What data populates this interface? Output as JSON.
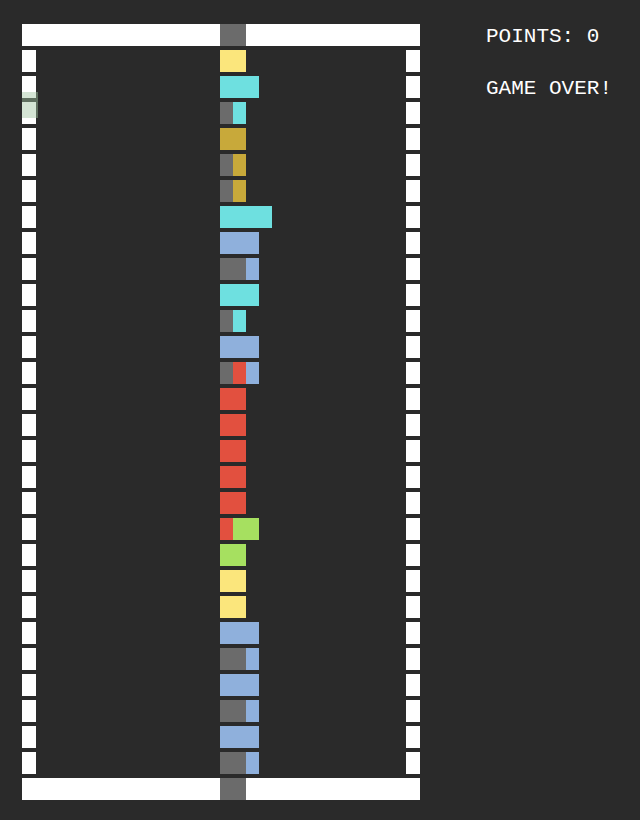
{
  "status": {
    "points": "POINTS: 0",
    "message": "GAME OVER!"
  },
  "ghost_piece": {
    "visible": true,
    "color": "#9fc49f"
  },
  "board": {
    "rows": [
      [
        "#fbe67c",
        "#fbe67c"
      ],
      [
        "#6ee0e0",
        "#6ee0e0",
        "#6ee0e0"
      ],
      [
        "#6b6b6b",
        "#6ee0e0"
      ],
      [
        "#c8a93a",
        "#c8a93a"
      ],
      [
        "#6b6b6b",
        "#c8a93a"
      ],
      [
        "#6b6b6b",
        "#c8a93a"
      ],
      [
        "#6ee0e0",
        "#6ee0e0",
        "#6ee0e0",
        "#6ee0e0"
      ],
      [
        "#8fb0dc",
        "#8fb0dc",
        "#8fb0dc"
      ],
      [
        "#6b6b6b",
        "#6b6b6b",
        "#8fb0dc"
      ],
      [
        "#6ee0e0",
        "#6ee0e0",
        "#6ee0e0"
      ],
      [
        "#6b6b6b",
        "#6ee0e0"
      ],
      [
        "#8fb0dc",
        "#8fb0dc",
        "#8fb0dc"
      ],
      [
        "#6b6b6b",
        "#e2503f",
        "#8fb0dc"
      ],
      [
        "#e2503f",
        "#e2503f"
      ],
      [
        "#e2503f",
        "#e2503f"
      ],
      [
        "#e2503f",
        "#e2503f"
      ],
      [
        "#e2503f",
        "#e2503f"
      ],
      [
        "#e2503f",
        "#e2503f"
      ],
      [
        "#e2503f",
        "#a6e060",
        "#a6e060"
      ],
      [
        "#a6e060",
        "#a6e060"
      ],
      [
        "#fbe67c",
        "#fbe67c"
      ],
      [
        "#fbe67c",
        "#fbe67c"
      ],
      [
        "#8fb0dc",
        "#8fb0dc",
        "#8fb0dc"
      ],
      [
        "#6b6b6b",
        "#6b6b6b",
        "#8fb0dc"
      ],
      [
        "#8fb0dc",
        "#8fb0dc",
        "#8fb0dc"
      ],
      [
        "#6b6b6b",
        "#6b6b6b",
        "#8fb0dc"
      ],
      [
        "#8fb0dc",
        "#8fb0dc",
        "#8fb0dc"
      ],
      [
        "#6b6b6b",
        "#6b6b6b",
        "#8fb0dc"
      ]
    ]
  }
}
